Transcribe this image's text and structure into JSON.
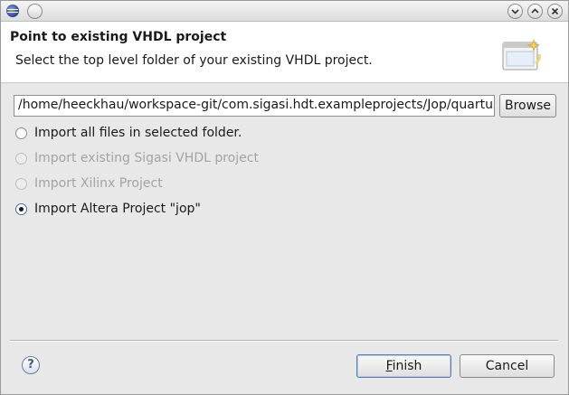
{
  "window": {
    "minimize_icon": "chevron-down-icon",
    "maximize_icon": "chevron-up-icon",
    "close_icon": "close-icon"
  },
  "banner": {
    "title": "Point to existing VHDL project",
    "message": "Select the top level folder of your existing VHDL project."
  },
  "folder": {
    "path": "/home/heeckhau/workspace-git/com.sigasi.hdt.exampleprojects/Jop/quartus/u",
    "browse_label": "Browse"
  },
  "options": [
    {
      "label": "Import all files in selected folder.",
      "enabled": true,
      "checked": false
    },
    {
      "label": "Import existing Sigasi VHDL project",
      "enabled": false,
      "checked": false
    },
    {
      "label": "Import Xilinx Project",
      "enabled": false,
      "checked": false
    },
    {
      "label": "Import Altera Project \"jop\"",
      "enabled": true,
      "checked": true
    }
  ],
  "footer": {
    "help_glyph": "?",
    "finish_mnemonic": "F",
    "finish_rest": "inish",
    "cancel_label": "Cancel"
  }
}
